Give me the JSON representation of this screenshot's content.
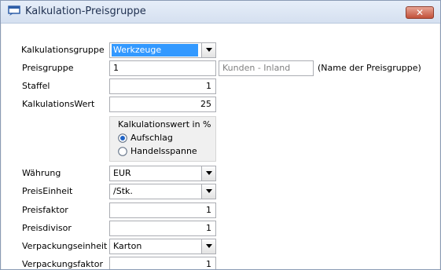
{
  "window": {
    "title": "Kalkulation-Preisgruppe",
    "close_label": "✕"
  },
  "form": {
    "kalkulationsgruppe": {
      "label": "Kalkulationsgruppe",
      "value": "Werkzeuge"
    },
    "preisgruppe": {
      "label": "Preisgruppe",
      "value": "1",
      "name_value": "Kunden - Inland",
      "hint": "(Name der Preisgruppe)"
    },
    "staffel": {
      "label": "Staffel",
      "value": "1"
    },
    "kalkulationswert": {
      "label": "KalkulationsWert",
      "value": "25"
    },
    "kalkulationswert_mode": {
      "title": "Kalkulationswert in %",
      "options": [
        "Aufschlag",
        "Handelsspanne"
      ],
      "selected": "Aufschlag"
    },
    "waehrung": {
      "label": "Währung",
      "value": "EUR"
    },
    "preiseinheit": {
      "label": "PreisEinheit",
      "value": "/Stk."
    },
    "preisfaktor": {
      "label": "Preisfaktor",
      "value": "1"
    },
    "preisdivisor": {
      "label": "Preisdivisor",
      "value": "1"
    },
    "verpackungseinheit": {
      "label": "Verpackungseinheit",
      "value": "Karton"
    },
    "verpackungsfaktor": {
      "label": "Verpackungsfaktor",
      "value": "1"
    }
  },
  "colors": {
    "selection": "#3399ff",
    "close_button": "#c2513a",
    "border": "#abadb3"
  }
}
